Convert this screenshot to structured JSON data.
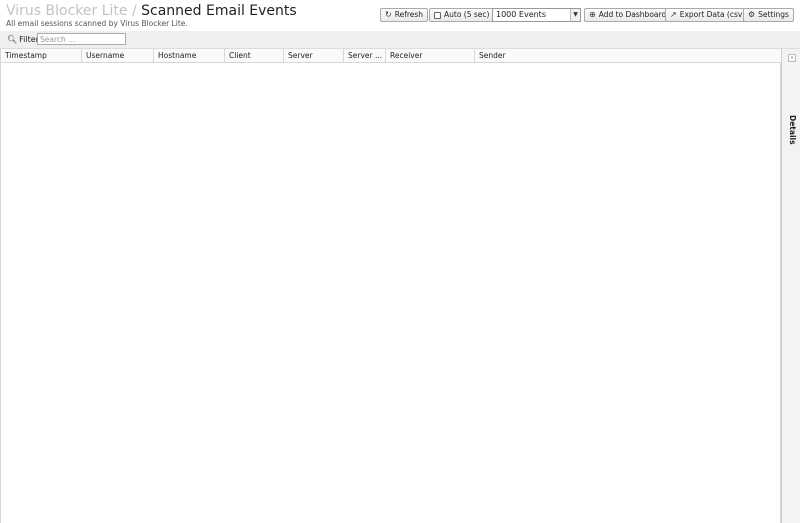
{
  "header": {
    "breadcrumb_parent": "Virus Blocker Lite",
    "separator": "/",
    "title": "Scanned Email Events",
    "subtitle": "All email sessions scanned by Virus Blocker Lite."
  },
  "toolbar": {
    "refresh_label": "Refresh",
    "auto_label": "Auto (5 sec)",
    "auto_checked": false,
    "events_select_value": "1000 Events",
    "add_dashboard_label": "Add to Dashboard",
    "export_label": "Export Data (csv)",
    "settings_label": "Settings"
  },
  "filter": {
    "label": "Filter",
    "placeholder": "Search ..."
  },
  "grid": {
    "columns": [
      "Timestamp",
      "Username",
      "Hostname",
      "Client",
      "Server",
      "Server ...",
      "Receiver",
      "Sender"
    ]
  },
  "details": {
    "label": "Details"
  },
  "icons": {
    "refresh": "refresh-icon",
    "search": "search-icon",
    "add": "plus-icon",
    "export": "export-icon",
    "settings": "gear-icon"
  }
}
